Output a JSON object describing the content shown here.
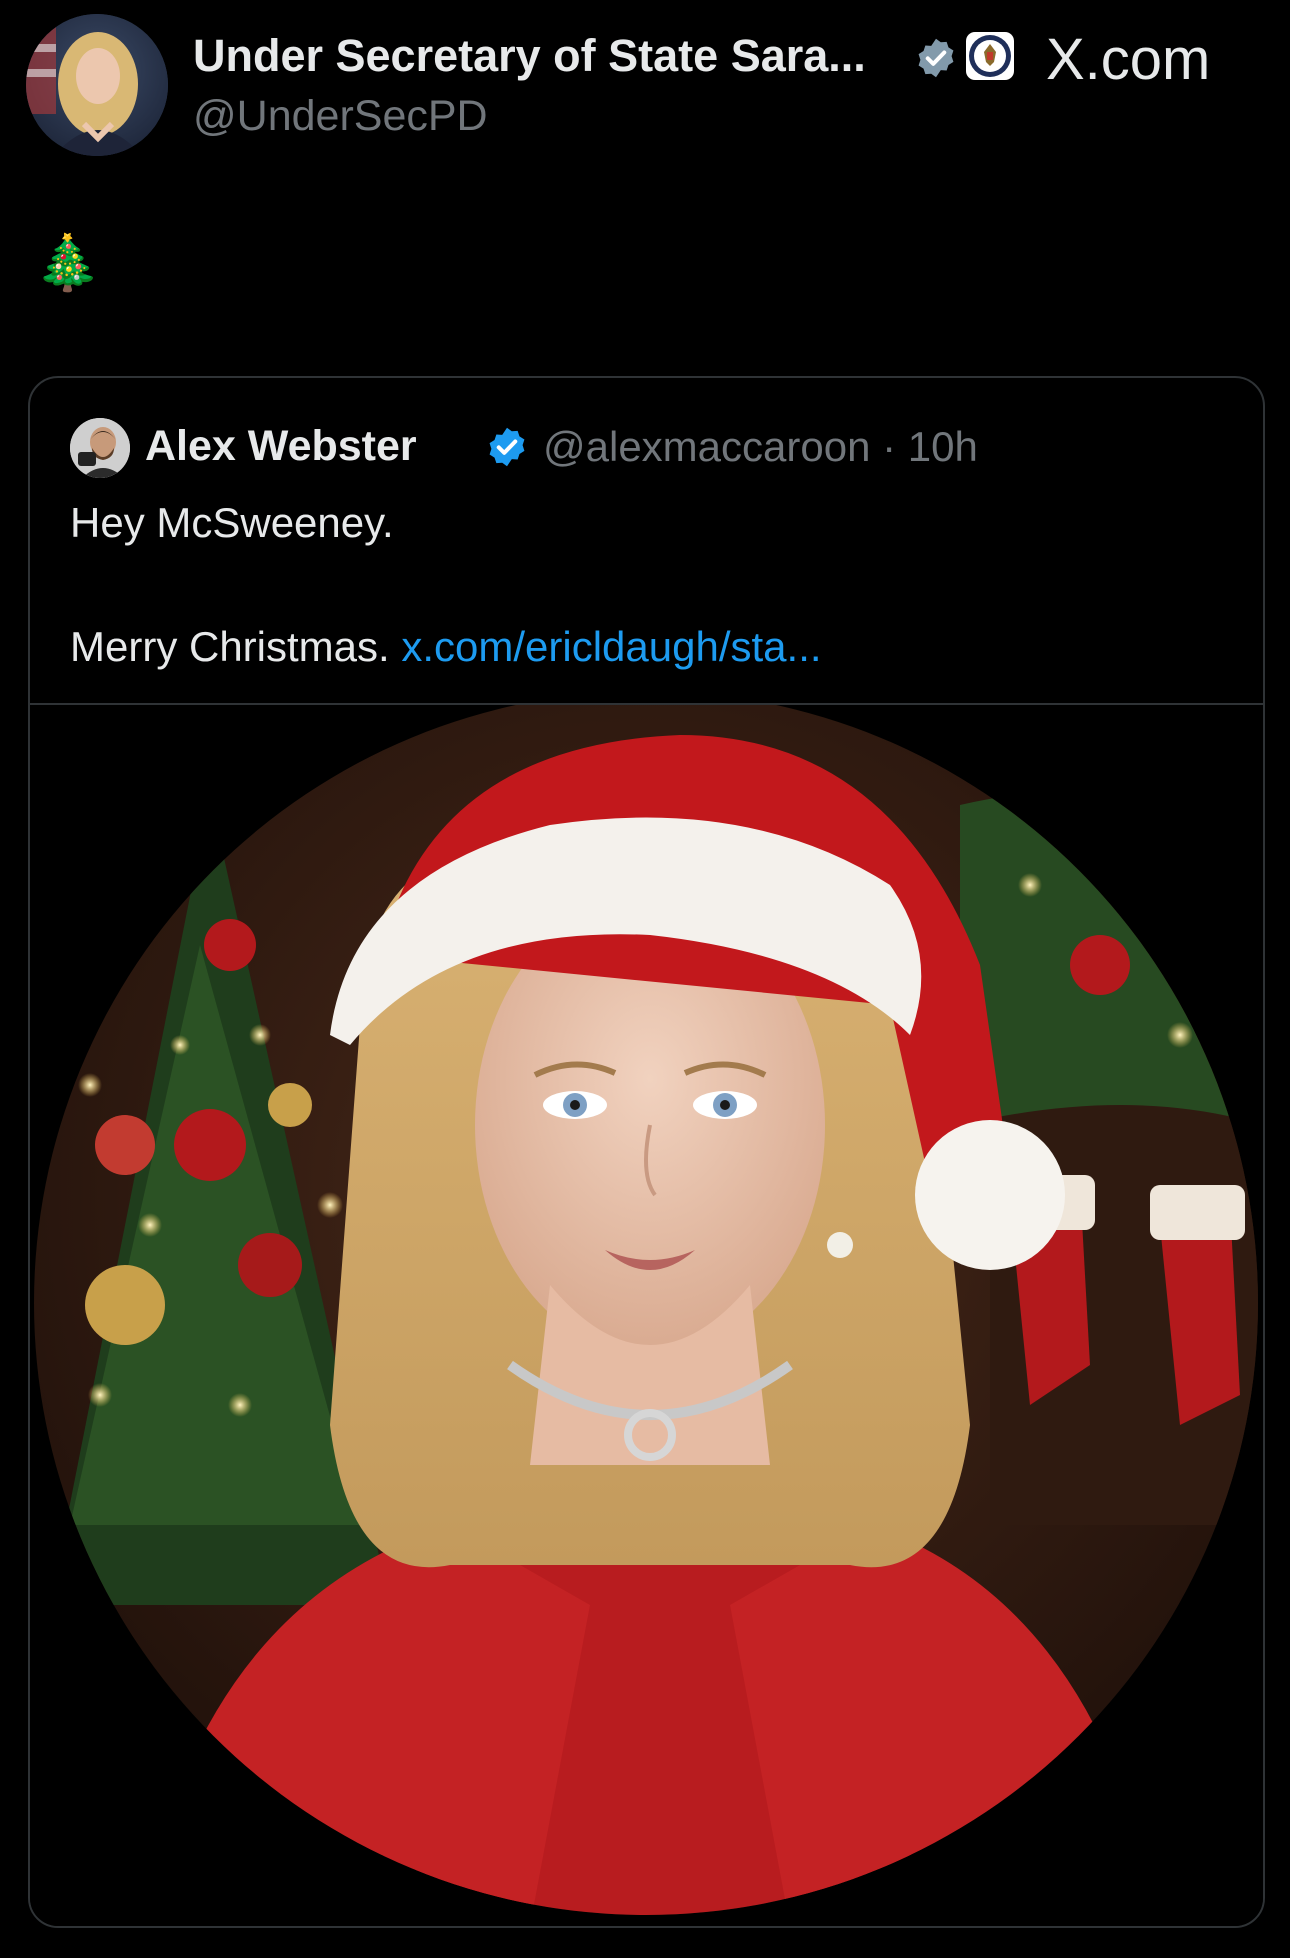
{
  "header": {
    "display_name": "Under Secretary of State Sara...",
    "handle": "@UnderSecPD",
    "brand": "X.com",
    "verified_badge": "verified-badge-icon",
    "affiliation_badge": "state-department-seal-icon"
  },
  "tweet": {
    "text": "🎄"
  },
  "quote": {
    "name": "Alex Webster",
    "handle": "@alexmaccaroon · 10h",
    "line1": "Hey McSweeney.",
    "line2_text": "Merry Christmas.",
    "link": "x.com/ericldaugh/sta...",
    "verified_badge": "verified-badge-icon"
  },
  "media": {
    "image": "santa-hat-portrait-image"
  },
  "colors": {
    "background": "#000000",
    "text": "#e7e9ea",
    "muted": "#71767b",
    "link": "#1d9bf0",
    "verified": "#1d9bf0",
    "border": "#2f3336"
  }
}
